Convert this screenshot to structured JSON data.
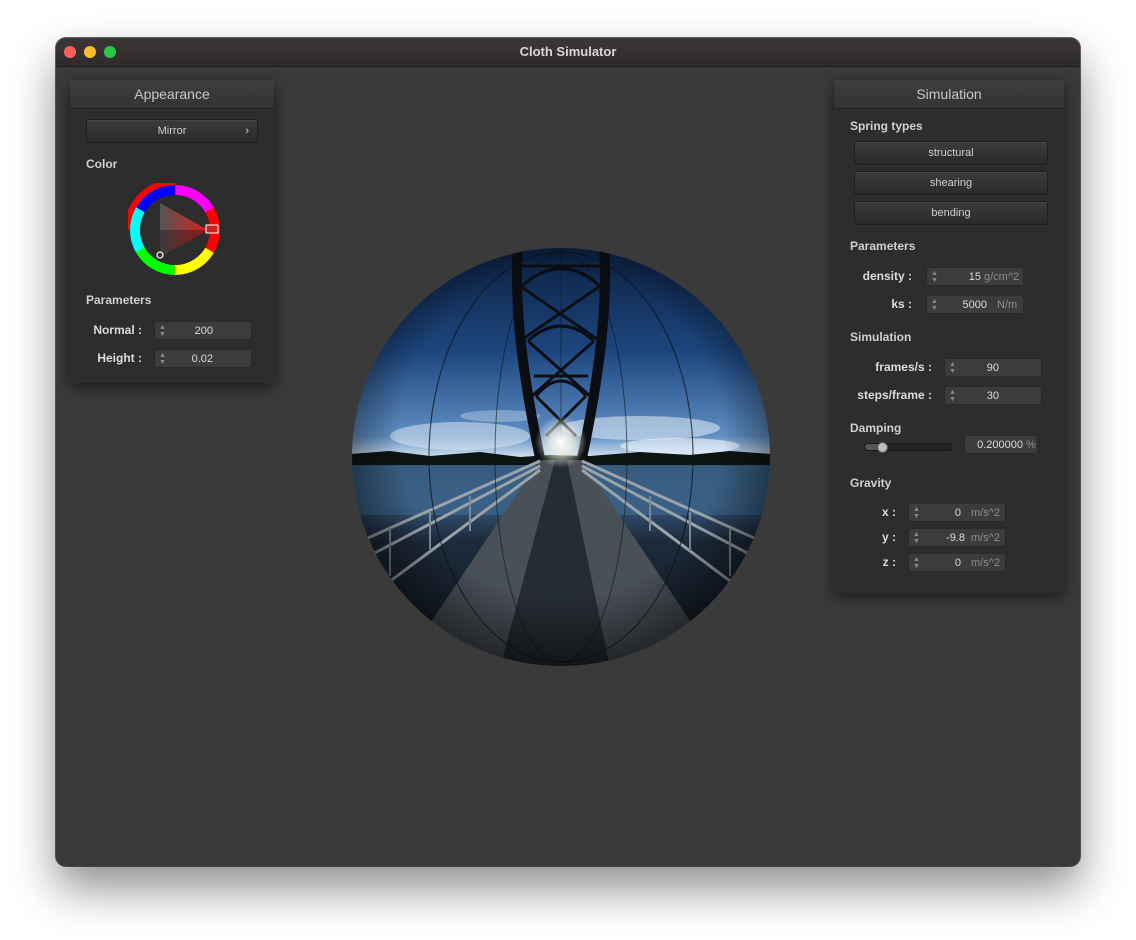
{
  "window": {
    "title": "Cloth Simulator"
  },
  "appearance": {
    "header": "Appearance",
    "shader": {
      "label": "Mirror",
      "arrow": "›"
    },
    "color_label": "Color",
    "color_wheel": {
      "selected_color": "#cc2222"
    },
    "params_label": "Parameters",
    "normal": {
      "label": "Normal :",
      "value": "200"
    },
    "height": {
      "label": "Height :",
      "value": "0.02"
    }
  },
  "simulation": {
    "header": "Simulation",
    "spring_types_label": "Spring types",
    "springs": {
      "structural": "structural",
      "shearing": "shearing",
      "bending": "bending"
    },
    "params_label": "Parameters",
    "density": {
      "label": "density :",
      "value": "15",
      "unit": "g/cm^2"
    },
    "ks": {
      "label": "ks :",
      "value": "5000",
      "unit": "N/m"
    },
    "sim_label": "Simulation",
    "fps": {
      "label": "frames/s :",
      "value": "90"
    },
    "steps": {
      "label": "steps/frame :",
      "value": "30"
    },
    "damping_label": "Damping",
    "damping": {
      "value": "0.200000",
      "unit": "%",
      "slider_fraction": 0.2
    },
    "gravity_label": "Gravity",
    "gx": {
      "label": "x :",
      "value": "0",
      "unit": "m/s^2"
    },
    "gy": {
      "label": "y :",
      "value": "-9.8",
      "unit": "m/s^2"
    },
    "gz": {
      "label": "z :",
      "value": "0",
      "unit": "m/s^2"
    }
  },
  "scene": {
    "object": "mirror-sphere-bridge-reflection"
  }
}
